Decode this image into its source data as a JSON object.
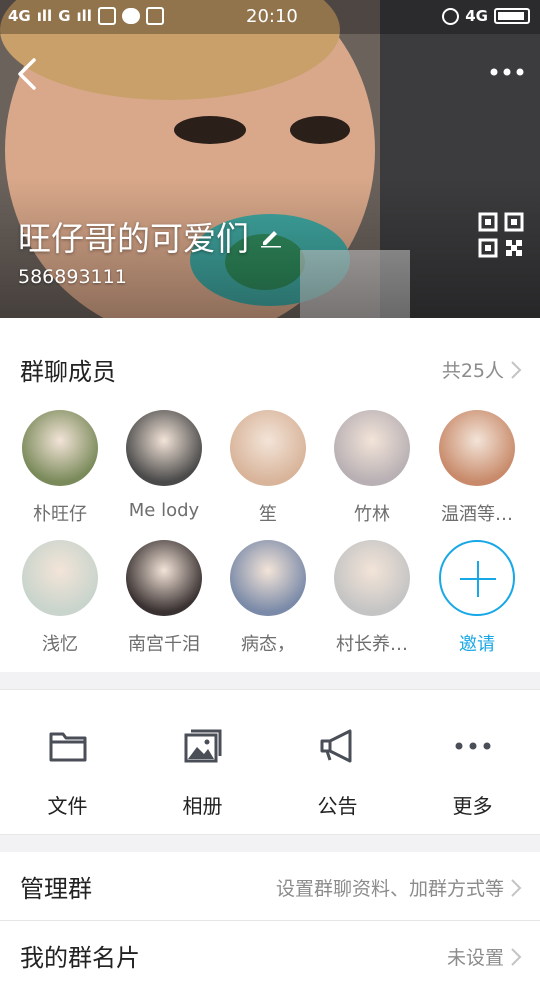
{
  "status_bar": {
    "signal_left": "4G",
    "signal_mid": "G",
    "time": "20:10",
    "network": "4G"
  },
  "header": {
    "group_name": "旺仔哥的可爱们",
    "group_id": "586893111"
  },
  "members_section": {
    "title": "群聊成员",
    "count_label": "共25人",
    "members": [
      {
        "name": "朴旺仔",
        "color": "#7a8a5a"
      },
      {
        "name": "Me  lody",
        "color": "#4a4a4a"
      },
      {
        "name": "笙",
        "color": "#d8b49a"
      },
      {
        "name": "竹林",
        "color": "#b8b0b4"
      },
      {
        "name": "温酒等…",
        "color": "#c88a6a"
      },
      {
        "name": "浅忆",
        "color": "#c8d4cc"
      },
      {
        "name": "南宫千泪",
        "color": "#3a3232"
      },
      {
        "name": "病态，",
        "color": "#7a8aa8"
      },
      {
        "name": "村长养…",
        "color": "#c4c4c4"
      }
    ],
    "invite_label": "邀请"
  },
  "functions": [
    {
      "label": "文件",
      "icon": "folder-icon"
    },
    {
      "label": "相册",
      "icon": "photo-album-icon"
    },
    {
      "label": "公告",
      "icon": "megaphone-icon"
    },
    {
      "label": "更多",
      "icon": "more-dots-icon"
    }
  ],
  "settings_rows": [
    {
      "title": "管理群",
      "value": "设置群聊资料、加群方式等"
    },
    {
      "title": "我的群名片",
      "value": "未设置"
    }
  ],
  "colors": {
    "accent": "#19a8e6",
    "secondary_text": "#8c8c8c",
    "background": "#f2f2f4"
  }
}
